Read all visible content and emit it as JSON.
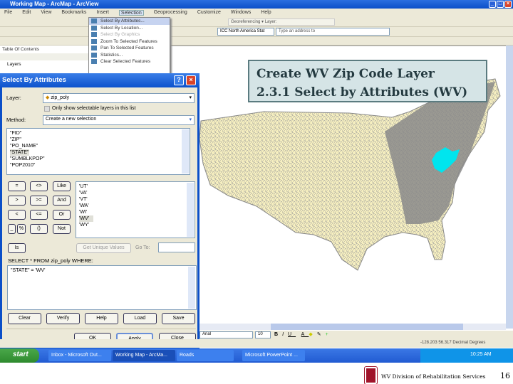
{
  "window": {
    "title": "Working Map - ArcMap - ArcView"
  },
  "menu": [
    "File",
    "Edit",
    "View",
    "Bookmarks",
    "Insert",
    "Selection",
    "Geoprocessing",
    "Customize",
    "Windows",
    "Help"
  ],
  "editor_toolbar": {
    "label": "Georeferencing ▾ Layer:"
  },
  "toolbar_combo": {
    "layer": "ICC North America Stat",
    "search_placeholder": "Type an address to"
  },
  "toc": {
    "title": "Table Of Contents",
    "layers": "Layers"
  },
  "selection_menu": [
    {
      "label": "Select By Attributes...",
      "state": "highlighted"
    },
    {
      "label": "Select By Location...",
      "state": "normal"
    },
    {
      "label": "Select By Graphics",
      "state": "disabled"
    },
    {
      "label": "Zoom To Selected Features",
      "state": "normal"
    },
    {
      "label": "Pan To Selected Features",
      "state": "normal"
    },
    {
      "label": "Statistics...",
      "state": "normal"
    },
    {
      "label": "Clear Selected Features",
      "state": "normal"
    }
  ],
  "dialog": {
    "title": "Select By Attributes",
    "layer_label": "Layer:",
    "layer_value": "zip_poly",
    "only_selectable_label": "Only show selectable layers in this list",
    "method_label": "Method:",
    "method_value": "Create a new selection",
    "fields": [
      "\"FID\"",
      "\"ZIP\"",
      "\"PO_NAME\"",
      "\"STATE\"",
      "\"SUMBLKPOP\"",
      "\"POP2010\""
    ],
    "selected_field": "\"STATE\"",
    "operators": [
      "=",
      "<>",
      "Like",
      ">",
      ">=",
      "And",
      "<",
      "<=",
      "Or",
      "_",
      "%",
      "()",
      "Not"
    ],
    "values": [
      "'UT'",
      "'VA'",
      "'VT'",
      "'WA'",
      "'WI'",
      "'WV'",
      "'WY'"
    ],
    "selected_value": "'WV'",
    "is_button": "Is",
    "get_unique_values": "Get Unique Values",
    "go_to_label": "Go To:",
    "go_to_value": "",
    "sql_label": "SELECT * FROM zip_poly WHERE:",
    "sql_value": "\"STATE\" = 'WV'",
    "buttons": [
      "Clear",
      "Verify",
      "Help",
      "Load",
      "Save"
    ],
    "ok": "OK",
    "apply": "Apply",
    "close": "Close"
  },
  "callout": {
    "line1": "Create WV Zip Code Layer",
    "line2": "2.3.1 Select by Attributes (WV)"
  },
  "drawing_toolbar": {
    "font": "Arial",
    "size": "10"
  },
  "status_bar": {
    "coords": "-128.203  56.317 Decimal Degrees"
  },
  "taskbar": {
    "start": "start",
    "tasks": [
      "Inbox - Microsoft Out...",
      "Working Map - ArcMa...",
      "Roads",
      "Microsoft PowerPoint ..."
    ],
    "clock": "10:25 AM"
  },
  "footer": {
    "org": "WV Division of Rehabilitation Services",
    "page": "16"
  },
  "colors": {
    "map_fill": "#f7f0c0",
    "map_border": "#808080",
    "selection": "#00e5ee",
    "xp_blue": "#0b4fc8"
  }
}
